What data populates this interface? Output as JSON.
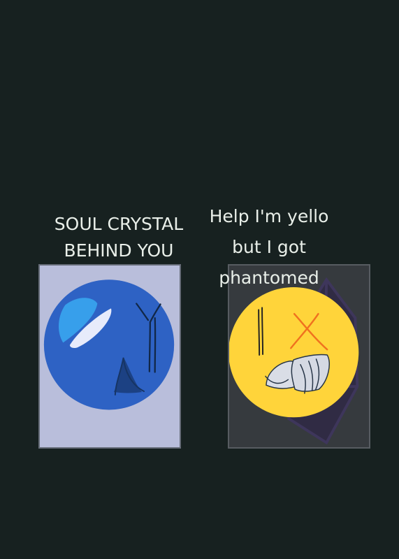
{
  "captions": {
    "left": "SOUL CRYSTAL BEHIND YOU",
    "right": "Help I'm yello but I got phantomed"
  },
  "colors": {
    "background": "#172120",
    "left_card": "#b9bedb",
    "right_card": "#363a3e",
    "blue_orb": "#2d63c2",
    "yellow_orb": "#ffd439",
    "phantom_shape": "#322c45",
    "caption_text": "#e9efe9"
  },
  "icons": {
    "left": "blue-orb-icon",
    "right": "yellow-orb-icon"
  }
}
